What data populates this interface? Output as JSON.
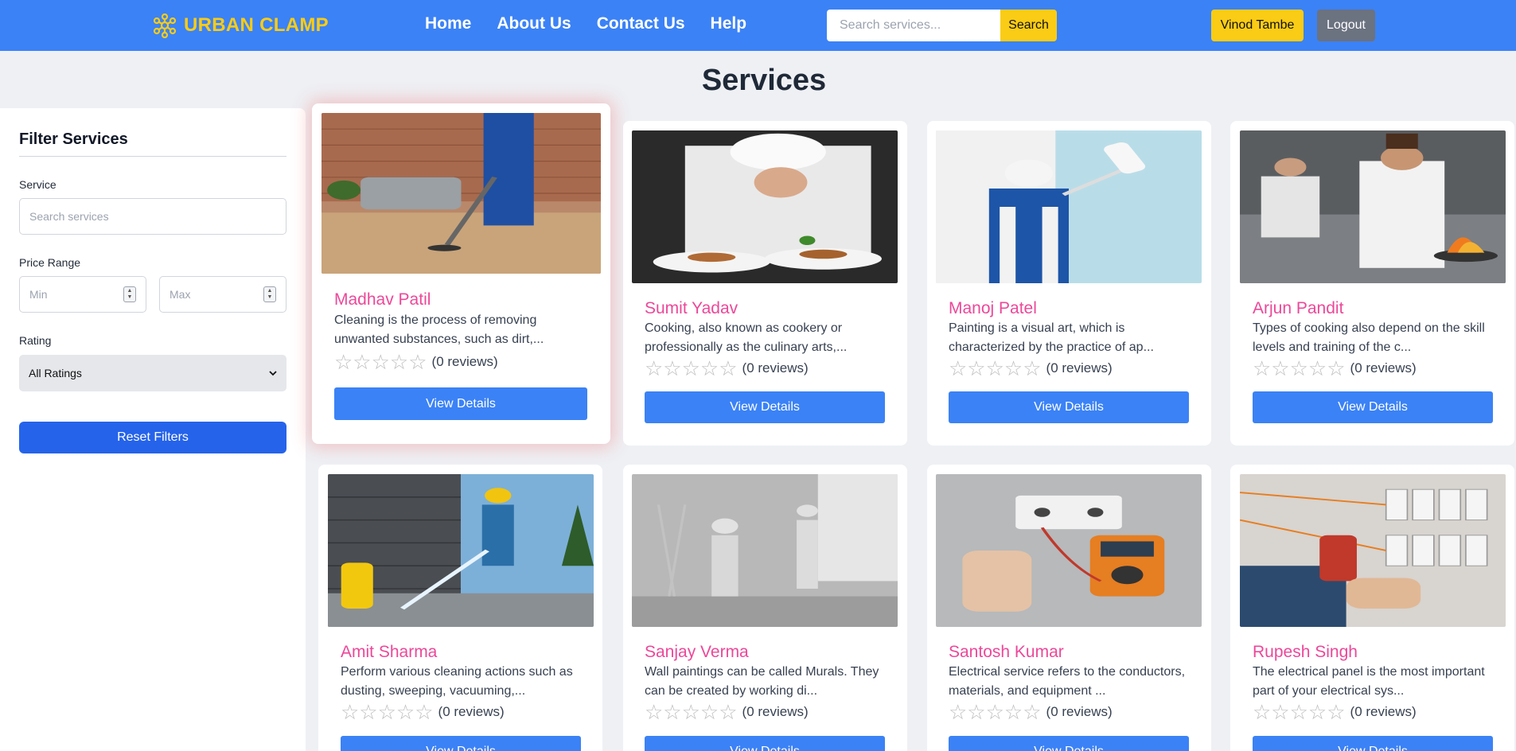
{
  "header": {
    "brand": "URBAN CLAMP",
    "nav": [
      "Home",
      "About Us",
      "Contact Us",
      "Help"
    ],
    "search_placeholder": "Search services...",
    "search_button": "Search",
    "user_button": "Vinod Tambe",
    "logout_button": "Logout"
  },
  "page_title": "Services",
  "filters": {
    "title": "Filter Services",
    "service_label": "Service",
    "service_placeholder": "Search services",
    "price_label": "Price Range",
    "min_placeholder": "Min",
    "max_placeholder": "Max",
    "rating_label": "Rating",
    "rating_selected": "All Ratings",
    "reset_button": "Reset Filters"
  },
  "services": [
    {
      "name": "Madhav Patil",
      "desc": "Cleaning is the process of removing unwanted substances, such as dirt,...",
      "reviews": "(0 reviews)",
      "button": "View Details",
      "image": "vacuum-cleaning-photo"
    },
    {
      "name": "Sumit Yadav",
      "desc": "Cooking, also known as cookery or professionally as the culinary arts,...",
      "reviews": "(0 reviews)",
      "button": "View Details",
      "image": "chef-plating-photo"
    },
    {
      "name": "Manoj Patel",
      "desc": "Painting is a visual art, which is characterized by the practice of ap...",
      "reviews": "(0 reviews)",
      "button": "View Details",
      "image": "wall-painter-photo"
    },
    {
      "name": "Arjun Pandit",
      "desc": "Types of cooking also depend on the skill levels and training of the c...",
      "reviews": "(0 reviews)",
      "button": "View Details",
      "image": "kitchen-chefs-photo"
    },
    {
      "name": "Amit Sharma",
      "desc": "Perform various cleaning actions such as dusting, sweeping, vacuuming,...",
      "reviews": "(0 reviews)",
      "button": "View Details",
      "image": "pressure-washing-photo"
    },
    {
      "name": "Sanjay Verma",
      "desc": "Wall paintings can be called Murals. They can be created by working di...",
      "reviews": "(0 reviews)",
      "button": "View Details",
      "image": "room-painters-photo"
    },
    {
      "name": "Santosh Kumar",
      "desc": "Electrical service refers to the conductors, materials, and equipment ...",
      "reviews": "(0 reviews)",
      "button": "View Details",
      "image": "multimeter-socket-photo"
    },
    {
      "name": "Rupesh Singh",
      "desc": "The electrical panel is the most important part of your electrical sys...",
      "reviews": "(0 reviews)",
      "button": "View Details",
      "image": "electrical-panel-photo"
    }
  ],
  "rating_stars": "☆☆☆☆☆"
}
